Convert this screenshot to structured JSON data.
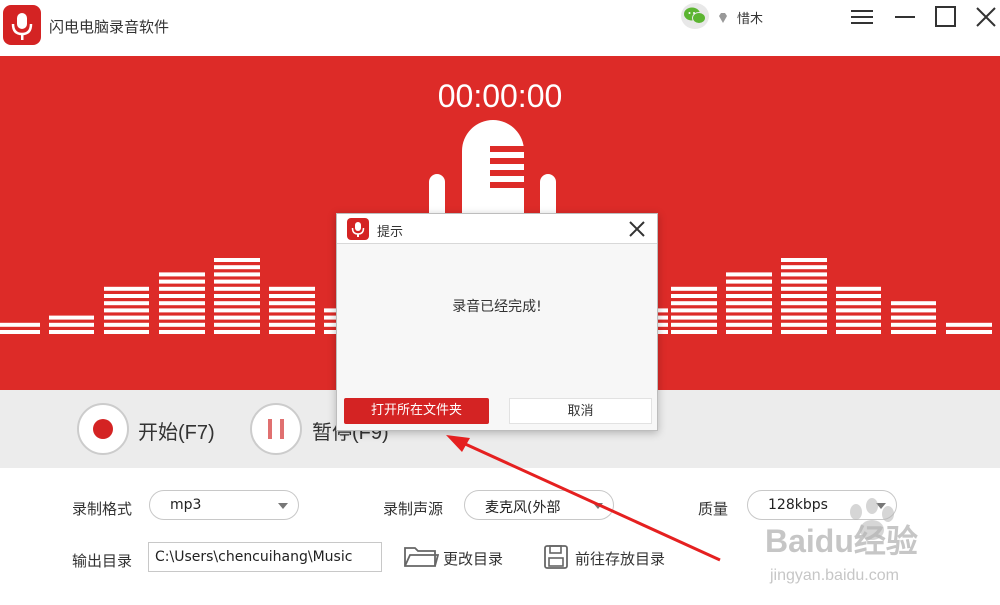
{
  "app": {
    "title": "闪电电脑录音软件",
    "username": "惜木",
    "accent": "#dd2b28"
  },
  "window_controls": {
    "menu": "menu-icon",
    "minimize": "minimize-icon",
    "maximize": "maximize-icon",
    "close": "close-icon"
  },
  "recorder": {
    "timer": "00:00:00"
  },
  "controls": {
    "start_label": "开始(F7)",
    "pause_label": "暂停(F9)"
  },
  "settings": {
    "format_label": "录制格式",
    "format_value": "mp3",
    "source_label": "录制声源",
    "source_value": "麦克风(外部",
    "quality_label": "质量",
    "quality_value": "128kbps",
    "output_label": "输出目录",
    "output_path": "C:\\Users\\chencuihang\\Music",
    "change_dir_label": "更改目录",
    "open_dir_label": "前往存放目录"
  },
  "dialog": {
    "title": "提示",
    "message": "录音已经完成!",
    "open_folder_label": "打开所在文件夹",
    "cancel_label": "取消"
  },
  "watermark": {
    "brand": "Baidu经验",
    "url": "jingyan.baidu.com"
  }
}
